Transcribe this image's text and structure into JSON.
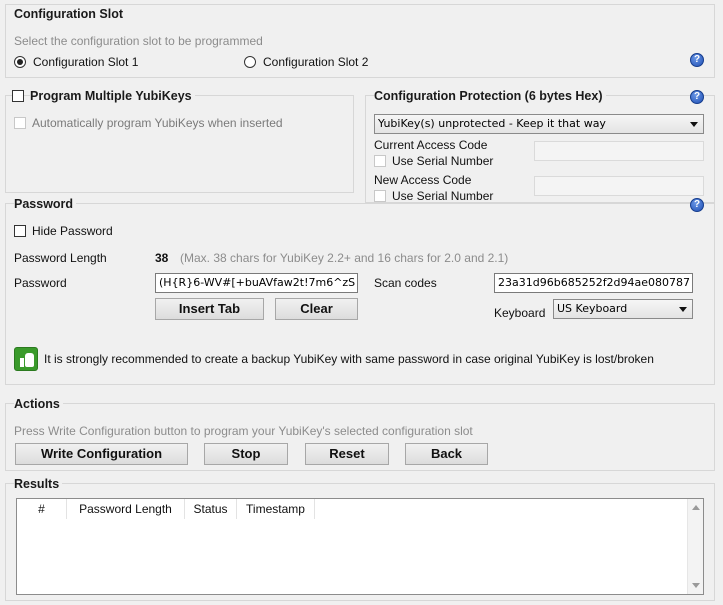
{
  "config_slot": {
    "title": "Configuration Slot",
    "subtitle": "Select the configuration slot to be programmed",
    "slot1_label": "Configuration Slot 1",
    "slot2_label": "Configuration Slot 2",
    "selected": "slot1"
  },
  "multiple": {
    "title": "Program Multiple YubiKeys",
    "auto_label": "Automatically program YubiKeys when inserted"
  },
  "protection": {
    "title": "Configuration Protection (6 bytes Hex)",
    "select_value": "YubiKey(s) unprotected - Keep it that way",
    "current_access_label": "Current Access Code",
    "current_serial_label": "Use Serial Number",
    "new_access_label": "New Access Code",
    "new_serial_label": "Use Serial Number"
  },
  "password": {
    "title": "Password",
    "hide_label": "Hide Password",
    "length_label": "Password Length",
    "length_value": "38",
    "length_note": "(Max. 38 chars for YubiKey 2.2+ and 16 chars for 2.0 and 2.1)",
    "password_label": "Password",
    "password_value": "(H{R}6-WV#[+buAVfaw2t!7m6^zS",
    "insert_tab_label": "Insert Tab",
    "clear_label": "Clear",
    "scan_codes_label": "Scan codes",
    "scan_codes_value": "23a31d96b685252f2d94ae080787",
    "keyboard_label": "Keyboard",
    "keyboard_value": "US Keyboard",
    "recommendation": "It is strongly recommended to create a backup YubiKey with same password in case original YubiKey is lost/broken"
  },
  "actions": {
    "title": "Actions",
    "subtitle": "Press Write Configuration button to program your YubiKey's selected configuration slot",
    "write_label": "Write Configuration",
    "stop_label": "Stop",
    "reset_label": "Reset",
    "back_label": "Back"
  },
  "results": {
    "title": "Results",
    "columns": [
      "#",
      "Password Length",
      "Status",
      "Timestamp"
    ]
  },
  "help_glyph": "?",
  "colors": {
    "help_blue": "#1f4fb4",
    "success_green": "#3a9a2b"
  }
}
